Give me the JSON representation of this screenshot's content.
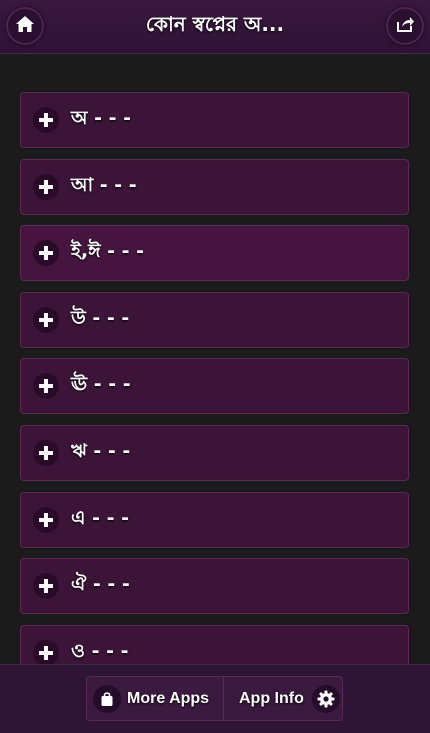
{
  "header": {
    "title": "কোন স্বপ্নের অ...",
    "home_icon": "home-icon",
    "share_icon": "share-icon"
  },
  "items": [
    {
      "label": "অ - - -"
    },
    {
      "label": "আ - - -"
    },
    {
      "label": "ই,ঈ - - -"
    },
    {
      "label": "উ - - -"
    },
    {
      "label": "ঊ - - -"
    },
    {
      "label": "ঋ - - -"
    },
    {
      "label": "এ - - -"
    },
    {
      "label": "ঐ - - -"
    },
    {
      "label": "ও - - -"
    }
  ],
  "footer": {
    "more_apps_label": "More Apps",
    "app_info_label": "App Info",
    "more_apps_icon": "shopping-bag-icon",
    "app_info_icon": "gear-icon"
  },
  "colors": {
    "accent": "#3b1438",
    "header_bg": "#2e1234",
    "page_bg": "#1b1b1b"
  }
}
